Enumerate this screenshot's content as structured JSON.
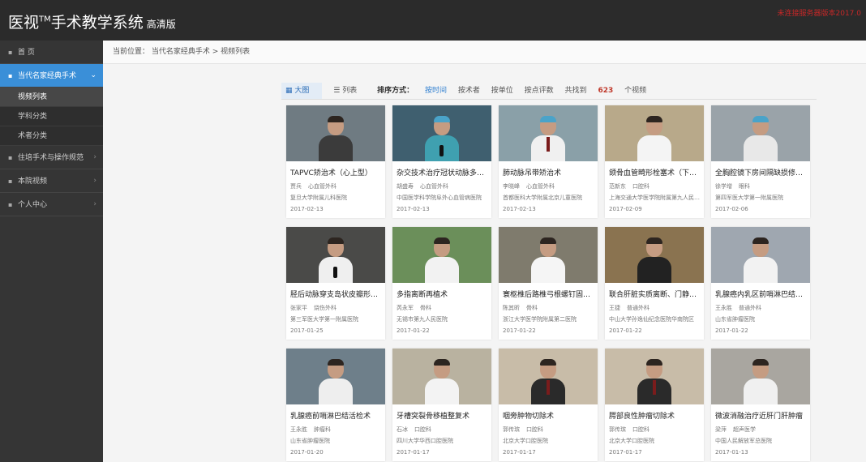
{
  "header": {
    "brand_prefix": "医视",
    "brand_tm": "TM",
    "brand_suffix": "手术教学系统",
    "hd_label": "高清版",
    "top_right": "未连接服务器版本2017.0"
  },
  "sidebar": {
    "items": [
      {
        "label": "首 页"
      },
      {
        "label": "当代名家经典手术"
      },
      {
        "label": "住培手术与操作规范"
      },
      {
        "label": "本院视频"
      },
      {
        "label": "个人中心"
      }
    ],
    "sub_items": [
      {
        "label": "视频列表"
      },
      {
        "label": "学科分类"
      },
      {
        "label": "术者分类"
      }
    ]
  },
  "breadcrumb": {
    "prefix": "当前位置：",
    "path": "当代名家经典手术 > 视频列表"
  },
  "toolbar": {
    "view_grid": "大图",
    "view_list": "列表",
    "sort_label": "排序方式：",
    "sort_time": "按时间",
    "sort_author": "按术者",
    "sort_unit": "按单位",
    "sort_score": "按点评数",
    "total_prefix": "共找到",
    "total_count": "623",
    "total_suffix": "个视频"
  },
  "videos": [
    {
      "title": "TAPVC矫治术（心上型）",
      "author": "贾兵",
      "dept": "心血管外科",
      "hospital": "复旦大学附属儿科医院",
      "date": "2017-02-13"
    },
    {
      "title": "杂交技术治疗冠状动脉多支病变",
      "author": "胡盛寿",
      "dept": "心血管外科",
      "hospital": "中国医学科学院阜外心血管病医院",
      "date": "2017-02-13"
    },
    {
      "title": "肺动脉吊带矫治术",
      "author": "李晓峰",
      "dept": "心血管外科",
      "hospital": "首都医科大学附属北京儿童医院",
      "date": "2017-02-13"
    },
    {
      "title": "颌骨血管畸形栓塞术（下颌骨）",
      "author": "范新东",
      "dept": "口腔科",
      "hospital": "上海交通大学医学院附属第九人民医院",
      "date": "2017-02-09"
    },
    {
      "title": "全胸腔镜下房间隔缺损修补术",
      "author": "徐学增",
      "dept": "眼科",
      "hospital": "第四军医大学第一附属医院",
      "date": "2017-02-06"
    },
    {
      "title": "胫后动脉穿支岛状皮瓣形成术",
      "author": "张家平",
      "dept": "烧伤外科",
      "hospital": "第三军医大学第一附属医院",
      "date": "2017-01-25"
    },
    {
      "title": "多指离断再植术",
      "author": "芮永军",
      "dept": "骨科",
      "hospital": "无锡市第九人民医院",
      "date": "2017-01-22"
    },
    {
      "title": "寰枢椎后路椎弓根螺钉固定术",
      "author": "陈其昕",
      "dept": "骨科",
      "hospital": "浙江大学医学院附属第二医院",
      "date": "2017-01-22"
    },
    {
      "title": "联合肝脏实质离断、门静脉结扎",
      "author": "王捷",
      "dept": "普通外科",
      "hospital": "中山大学孙逸仙纪念医院华南院区",
      "date": "2017-01-22"
    },
    {
      "title": "乳腺癌内乳区前哨淋巴结活检术",
      "author": "王永胜",
      "dept": "普通外科",
      "hospital": "山东省肿瘤医院",
      "date": "2017-01-22"
    },
    {
      "title": "乳腺癌前哨淋巴结活检术",
      "author": "王永胜",
      "dept": "肿瘤科",
      "hospital": "山东省肿瘤医院",
      "date": "2017-01-20"
    },
    {
      "title": "牙槽突裂骨移植整复术",
      "author": "石冰",
      "dept": "口腔科",
      "hospital": "四川大学华西口腔医院",
      "date": "2017-01-17"
    },
    {
      "title": "咽旁肿物切除术",
      "author": "郭传瑸",
      "dept": "口腔科",
      "hospital": "北京大学口腔医院",
      "date": "2017-01-17"
    },
    {
      "title": "腭部良性肿瘤切除术",
      "author": "郭传瑸",
      "dept": "口腔科",
      "hospital": "北京大学口腔医院",
      "date": "2017-01-17"
    },
    {
      "title": "微波消融治疗近肝门肝肿瘤",
      "author": "梁萍",
      "dept": "超声医学",
      "hospital": "中国人民解放军总医院",
      "date": "2017-01-13"
    }
  ]
}
